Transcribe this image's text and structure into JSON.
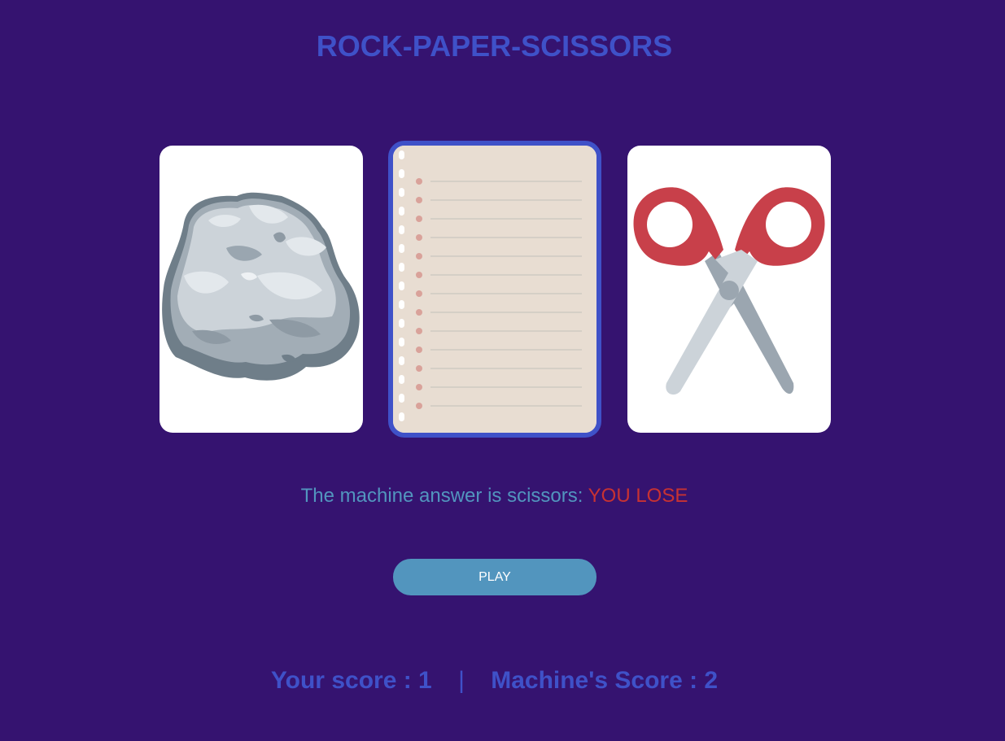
{
  "title": "ROCK-PAPER-SCISSORS",
  "cards": {
    "rock": {
      "icon": "rock-icon",
      "selected": false
    },
    "paper": {
      "icon": "notebook-paper-icon",
      "selected": true
    },
    "scissors": {
      "icon": "scissors-icon",
      "selected": false
    }
  },
  "result": {
    "message": "The machine answer is scissors:",
    "outcome": "YOU LOSE"
  },
  "play_button": {
    "label": "PLAY"
  },
  "scores": {
    "player_label": "Your score : 1",
    "separator": "|",
    "machine_label": "Machine's Score : 2"
  },
  "colors": {
    "background": "#351370",
    "accent": "#3f51c8",
    "button": "#5295be",
    "lose": "#c83232"
  }
}
